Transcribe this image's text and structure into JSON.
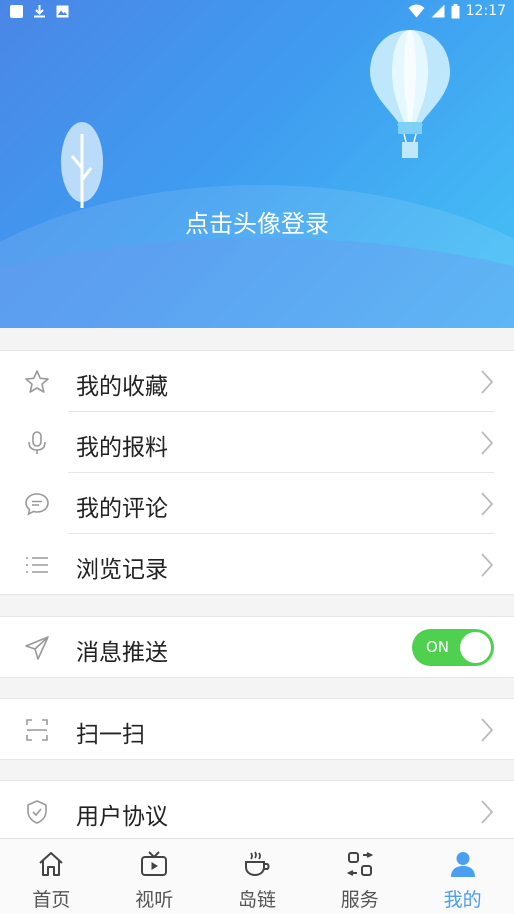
{
  "status_bar": {
    "time": "12:17"
  },
  "header": {
    "login_prompt": "点击头像登录"
  },
  "menu_group1": {
    "items": [
      {
        "label": "我的收藏",
        "icon": "star-icon"
      },
      {
        "label": "我的报料",
        "icon": "microphone-icon"
      },
      {
        "label": "我的评论",
        "icon": "comment-icon"
      },
      {
        "label": "浏览记录",
        "icon": "list-icon"
      }
    ]
  },
  "menu_push": {
    "label": "消息推送",
    "toggle_label": "ON",
    "toggle_on": true
  },
  "menu_scan": {
    "label": "扫一扫"
  },
  "menu_agreement": {
    "label": "用户协议"
  },
  "tabbar": {
    "tabs": [
      {
        "label": "首页",
        "icon": "home-icon"
      },
      {
        "label": "视听",
        "icon": "tv-icon"
      },
      {
        "label": "岛链",
        "icon": "coffee-icon"
      },
      {
        "label": "服务",
        "icon": "services-icon"
      },
      {
        "label": "我的",
        "icon": "user-icon",
        "active": true
      }
    ]
  },
  "colors": {
    "accent": "#4a9ff1",
    "toggle_on": "#4fd04f"
  }
}
